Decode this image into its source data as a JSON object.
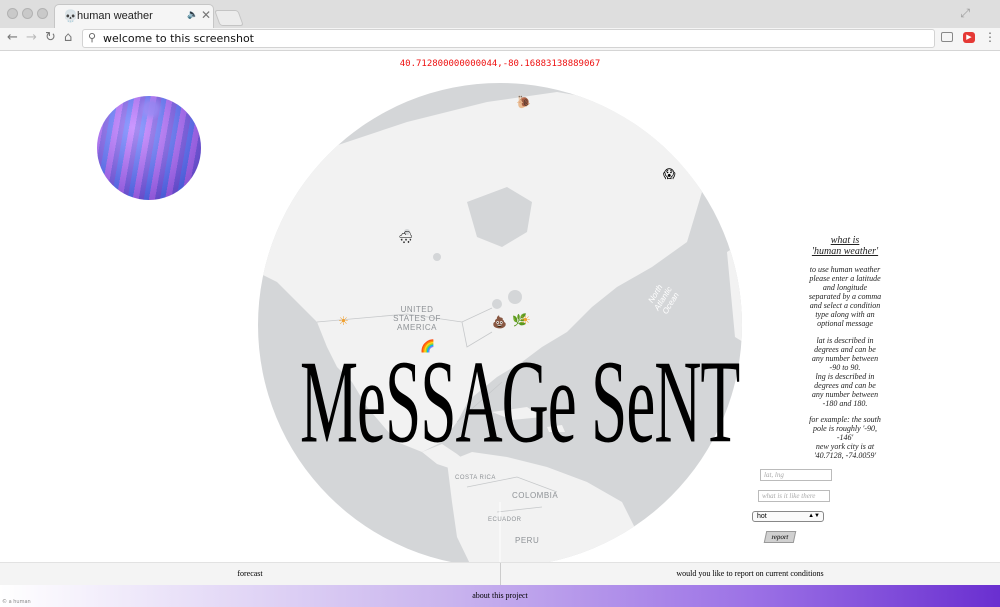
{
  "browser": {
    "tab_title": "human weather",
    "tab_favicon": "💀",
    "tab_audio_icon": "🔈",
    "tab_close": "✕",
    "address": "welcome to this screenshot",
    "nav_back": "←",
    "nav_forward": "→",
    "nav_reload": "↻",
    "nav_home": "⌂",
    "search_icon": "⚲",
    "extension_badge": "▶",
    "menu_icon": "⋮",
    "fullscreen_icon": "⤢"
  },
  "page": {
    "coordinates": "40.712800000000044,-80.16883138889067",
    "message_overlay": "MeSSAGe SeNT",
    "map_labels": {
      "usa": "UNITED\nSTATES OF\nAMERICA",
      "colombia": "COLOMBIA",
      "ecuador": "ECUADOR",
      "peru": "PERU",
      "costa_rica": "COSTA RICA",
      "ocean": "North\nAtlantic\nOcean"
    },
    "markers": [
      {
        "name": "snail-marker",
        "emoji": "🐌"
      },
      {
        "name": "scream-marker",
        "emoji": "😱"
      },
      {
        "name": "snow-cloud-marker",
        "emoji": "🌨"
      },
      {
        "name": "sun-marker-west",
        "emoji": "☀"
      },
      {
        "name": "poop-marker",
        "emoji": "💩"
      },
      {
        "name": "leaf-marker",
        "emoji": "🌿"
      },
      {
        "name": "sun-marker-east",
        "emoji": "☀"
      },
      {
        "name": "rainbow-marker",
        "emoji": "🌈"
      }
    ],
    "info": {
      "title_line1": "what is",
      "title_line2": "'human weather'",
      "p1": [
        "to use human weather",
        "please enter a latitude",
        "and longitude",
        "separated by a comma",
        "and select a condition",
        "type along with an",
        "optional message"
      ],
      "p2": [
        "lat is described in",
        "degrees and can be",
        "any number between",
        "-90 to 90.",
        "lng is described in",
        "degrees and can be",
        "any number between",
        "-180 and 180."
      ],
      "p3": [
        "for example: the south",
        "pole is roughly '-90,",
        "-146'",
        "new york city is at",
        "'40.7128, -74.0059'"
      ]
    },
    "form": {
      "latlng_placeholder": "lat, lng",
      "message_placeholder": "what is it like there",
      "condition_selected": "hot",
      "report_label": "report"
    },
    "footer": {
      "forecast": "forecast",
      "report_prompt": "would you like to report on current conditions",
      "about": "about this project",
      "corner_text": "© a human"
    }
  },
  "colors": {
    "coordinates": "#ee1111",
    "globe_land": "#f2f2f2",
    "globe_water": "#d4d6d8",
    "about_gradient_end": "#6a2fd0"
  }
}
